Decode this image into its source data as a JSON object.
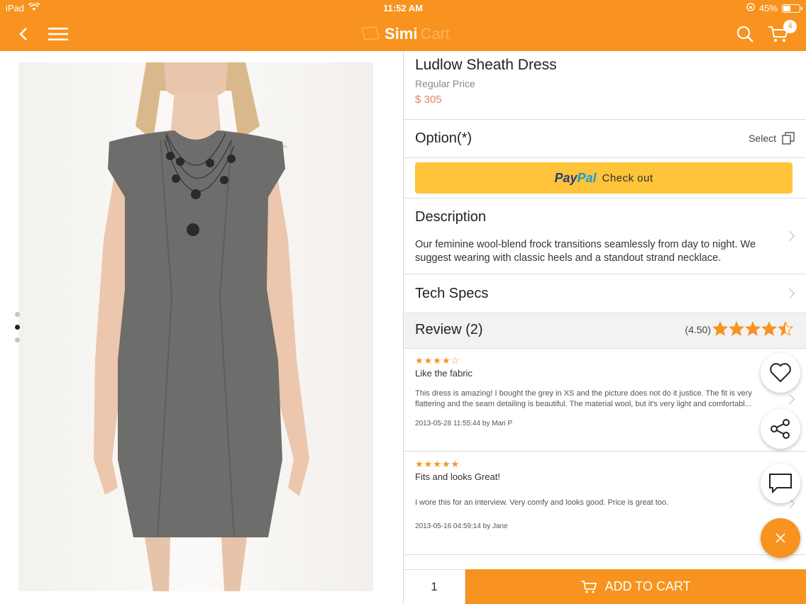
{
  "status_bar": {
    "device": "iPad",
    "time": "11:52 AM",
    "battery_percent": "45%",
    "battery_level": 0.45
  },
  "nav": {
    "logo_primary": "Simi",
    "logo_secondary": "Cart",
    "cart_count": "4"
  },
  "gallery": {
    "image_alt": "grey sleeveless sheath dress on model",
    "pages": 3,
    "active_page": 2
  },
  "product": {
    "name": "Ludlow Sheath Dress",
    "price_label": "Regular Price",
    "price": "$ 305"
  },
  "option": {
    "label": "Option(*)",
    "select_label": "Select"
  },
  "paypal": {
    "logo_pay": "Pay",
    "logo_pal": "Pal",
    "label": "Check out"
  },
  "description": {
    "title": "Description",
    "text": "Our feminine wool-blend frock transitions seamlessly from day to night. We suggest wearing with classic heels and a standout strand necklace."
  },
  "tech_specs": {
    "title": "Tech Specs"
  },
  "reviews": {
    "title": "Review (2)",
    "average": "(4.50)",
    "rating_value": 4.5,
    "items": [
      {
        "stars": "★★★★☆",
        "title": "Like the fabric",
        "body": "This dress is amazing! I bought the grey in XS and the picture does not do it justice. The fit is very flattering and the seam detailing is beautiful. The material wool, but it's very light and comfortabl...",
        "meta": "2013-05-28 11:55:44 by Mari P"
      },
      {
        "stars": "★★★★★",
        "title": "Fits and looks Great!",
        "body": "I wore this for an interview. Very comfy and looks good. Price is great too.",
        "meta": "2013-05-16 04:59:14 by Jane"
      }
    ]
  },
  "cart_bar": {
    "quantity": "1",
    "add_label": "ADD TO CART"
  },
  "colors": {
    "brand": "#f7931e",
    "paypal_yellow": "#ffc439",
    "price": "#d9836b"
  },
  "icons": [
    "back-icon",
    "menu-icon",
    "search-icon",
    "cart-icon",
    "copy-icon",
    "chevron-right-icon",
    "heart-icon",
    "share-icon",
    "chat-icon",
    "close-icon"
  ]
}
